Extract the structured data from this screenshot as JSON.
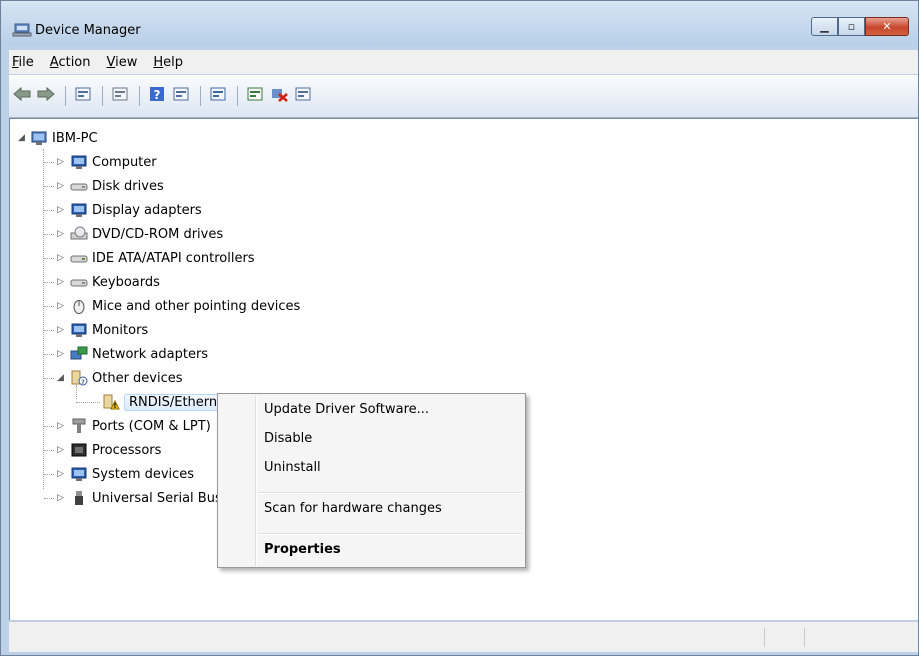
{
  "window": {
    "title": "Device Manager"
  },
  "menubar": [
    {
      "label": "File"
    },
    {
      "label": "Action"
    },
    {
      "label": "View"
    },
    {
      "label": "Help"
    }
  ],
  "toolbar": [
    {
      "name": "back-icon"
    },
    {
      "name": "forward-icon"
    },
    {
      "sep": true
    },
    {
      "name": "show-hide-console-tree-icon"
    },
    {
      "sep": true
    },
    {
      "name": "properties-icon"
    },
    {
      "sep": true
    },
    {
      "name": "help-icon"
    },
    {
      "name": "show-action-pane-icon"
    },
    {
      "sep": true
    },
    {
      "name": "scan-hardware-icon"
    },
    {
      "sep": true
    },
    {
      "name": "update-driver-icon"
    },
    {
      "name": "uninstall-icon"
    },
    {
      "name": "disable-icon"
    }
  ],
  "tree": {
    "root": "IBM-PC",
    "items": [
      {
        "label": "Computer",
        "icon": "computer-icon",
        "color": "#2a5db0"
      },
      {
        "label": "Disk drives",
        "icon": "disk-drive-icon",
        "color": "#8a8a8a"
      },
      {
        "label": "Display adapters",
        "icon": "display-adapter-icon",
        "color": "#2a5db0"
      },
      {
        "label": "DVD/CD-ROM drives",
        "icon": "dvd-drive-icon",
        "color": "#8a8a8a"
      },
      {
        "label": "IDE ATA/ATAPI controllers",
        "icon": "ide-controller-icon",
        "color": "#6a8f3a"
      },
      {
        "label": "Keyboards",
        "icon": "keyboard-icon",
        "color": "#8a8a8a"
      },
      {
        "label": "Mice and other pointing devices",
        "icon": "mouse-icon",
        "color": "#6a6a6a"
      },
      {
        "label": "Monitors",
        "icon": "monitor-icon",
        "color": "#2a5db0"
      },
      {
        "label": "Network adapters",
        "icon": "network-adapter-icon",
        "color": "#2a7a3a"
      },
      {
        "label": "Other devices",
        "icon": "unknown-device-icon",
        "color": "#c8a040",
        "expanded": true
      },
      {
        "label": "RNDIS/Ethernet Gadget",
        "icon": "warning-device-icon",
        "color": "#e0b020",
        "child": true,
        "selected": true
      },
      {
        "label": "Ports (COM & LPT)",
        "icon": "port-icon",
        "color": "#7a7a7a"
      },
      {
        "label": "Processors",
        "icon": "processor-icon",
        "color": "#505050"
      },
      {
        "label": "System devices",
        "icon": "system-device-icon",
        "color": "#2a5db0"
      },
      {
        "label": "Universal Serial Bus controllers",
        "icon": "usb-icon",
        "color": "#505050"
      }
    ]
  },
  "context_menu": {
    "items": [
      {
        "label": "Update Driver Software..."
      },
      {
        "label": "Disable"
      },
      {
        "label": "Uninstall"
      },
      {
        "sep": true
      },
      {
        "label": "Scan for hardware changes"
      },
      {
        "sep": true
      },
      {
        "label": "Properties",
        "bold": true
      }
    ]
  }
}
